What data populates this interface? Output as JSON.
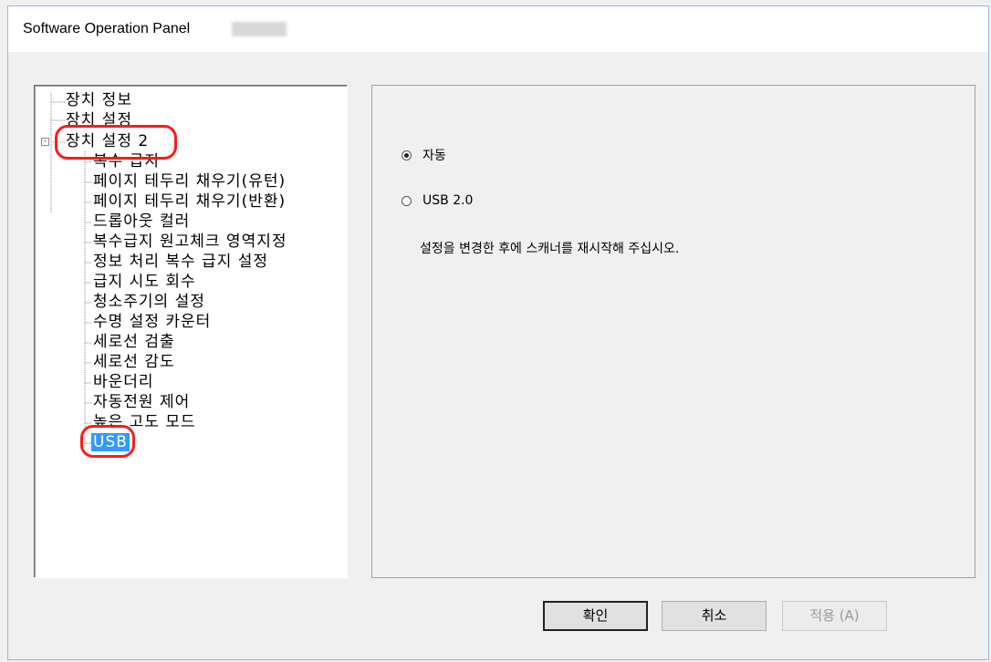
{
  "window": {
    "title": "Software Operation Panel"
  },
  "tree": {
    "nodes": [
      "장치 정보",
      "장치 설정",
      "장치 설정 2",
      "복수 급지",
      "페이지 테두리 채우기(유턴)",
      "페이지 테두리 채우기(반환)",
      "드롭아웃 컬러",
      "복수급지 원고체크 영역지정",
      "정보 처리 복수 급지 설정",
      "급지 시도 회수",
      "청소주기의 설정",
      "수명 설정 카운터",
      "세로선 검출",
      "세로선 감도",
      "바운더리",
      "자동전원 제어",
      "높은 고도 모드",
      "USB"
    ],
    "expander_symbol": "-",
    "selected": "USB",
    "highlight_color": "#ff1a1a"
  },
  "panel": {
    "options": [
      {
        "label": "자동",
        "checked": true
      },
      {
        "label": "USB 2.0",
        "checked": false
      }
    ],
    "note": "설정을 변경한 후에 스캐너를 재시작해 주십시오."
  },
  "buttons": {
    "ok": "확인",
    "cancel": "취소",
    "apply": "적용 (A)"
  }
}
